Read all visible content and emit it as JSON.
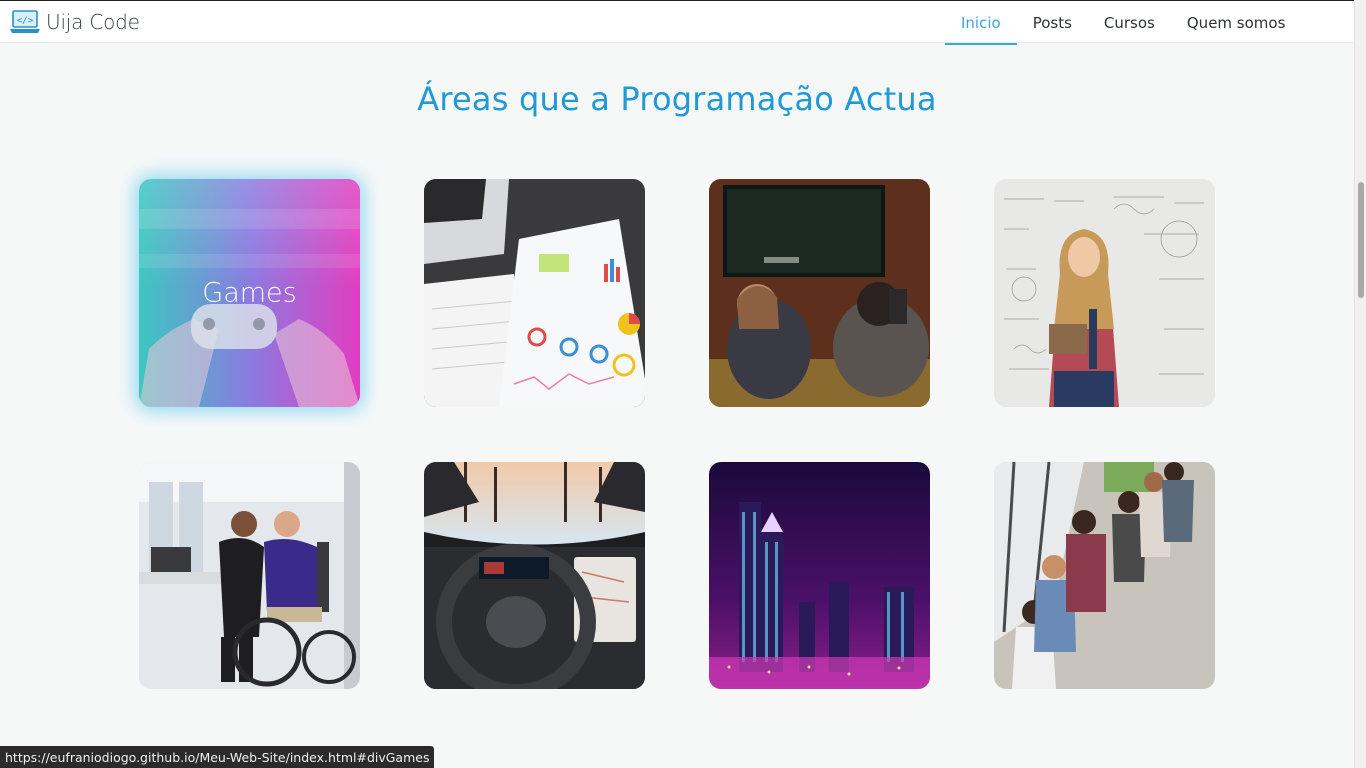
{
  "brand": {
    "name": "Uija Code",
    "icon": "laptop-code-icon"
  },
  "nav": {
    "items": [
      {
        "label": "Inicio",
        "active": true
      },
      {
        "label": "Posts",
        "active": false
      },
      {
        "label": "Cursos",
        "active": false
      },
      {
        "label": "Quem somos",
        "active": false
      }
    ]
  },
  "section": {
    "title": "Áreas que a Programação Actua"
  },
  "cards": [
    {
      "label": "Games",
      "image": "gamepad-hands-photo",
      "hovered": true
    },
    {
      "label": "",
      "image": "laptop-charts-photo",
      "hovered": false
    },
    {
      "label": "",
      "image": "people-watching-tv-photo",
      "hovered": false
    },
    {
      "label": "",
      "image": "girl-math-wall-photo",
      "hovered": false
    },
    {
      "label": "",
      "image": "wheelchair-prosthetic-photo",
      "hovered": false
    },
    {
      "label": "",
      "image": "tesla-dashboard-photo",
      "hovered": false
    },
    {
      "label": "",
      "image": "city-night-photo",
      "hovered": false
    },
    {
      "label": "",
      "image": "people-on-phones-photo",
      "hovered": false
    }
  ],
  "status_url": "https://eufraniodiogo.github.io/Meu-Web-Site/index.html#divGames",
  "colors": {
    "accent": "#1f9ad6",
    "nav_active": "#3aa8d8",
    "background": "#f6f8f8"
  }
}
